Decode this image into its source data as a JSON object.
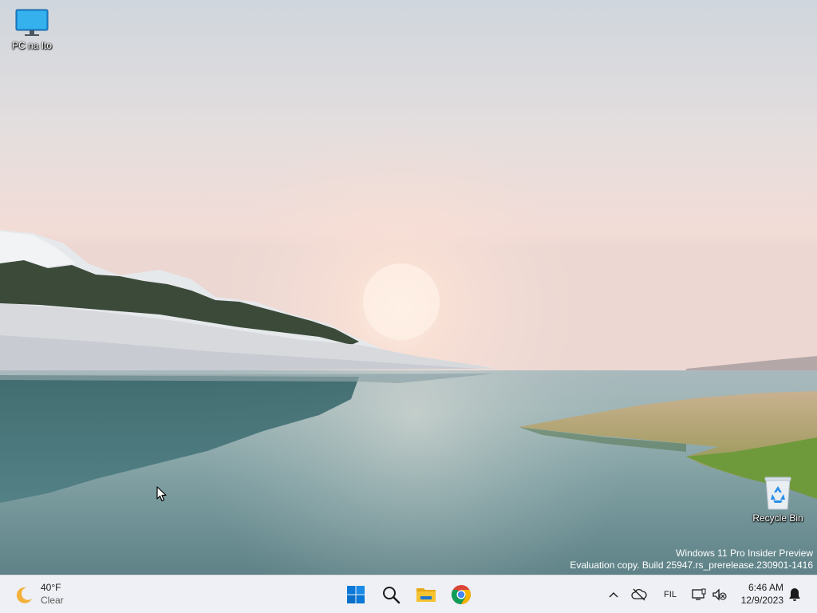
{
  "desktop": {
    "icons": [
      {
        "label": "PC na Ito",
        "icon": "monitor-icon"
      },
      {
        "label": "Recycle Bin",
        "icon": "recycle-bin-icon"
      }
    ],
    "watermark": {
      "line1": "Windows 11 Pro Insider Preview",
      "line2": "Evaluation copy. Build 25947.rs_prerelease.230901-1416"
    }
  },
  "taskbar": {
    "weather": {
      "temperature": "40°F",
      "condition": "Clear",
      "icon": "moon-icon"
    },
    "apps": [
      {
        "name": "Start",
        "icon": "windows-start-icon"
      },
      {
        "name": "Search",
        "icon": "search-icon"
      },
      {
        "name": "File Explorer",
        "icon": "folder-icon"
      },
      {
        "name": "Google Chrome",
        "icon": "chrome-icon"
      }
    ],
    "tray": {
      "language": "FIL",
      "time": "6:46 AM",
      "date": "12/9/2023"
    }
  },
  "colors": {
    "taskbar_bg": "#eef0f5",
    "start_blue": "#0a78d6",
    "folder_yellow": "#f5c231"
  }
}
